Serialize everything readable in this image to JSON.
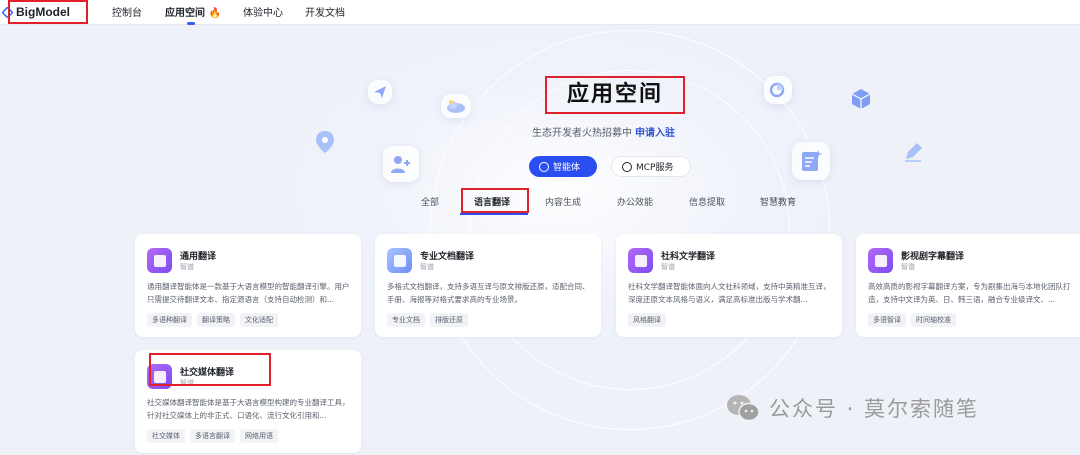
{
  "brand": {
    "name": "BigModel"
  },
  "nav": {
    "items": [
      {
        "label": "控制台"
      },
      {
        "label": "应用空间 🔥"
      },
      {
        "label": "体验中心"
      },
      {
        "label": "开发文档"
      }
    ]
  },
  "hero": {
    "title": "应用空间",
    "subtitle": "生态开发者火热招募中",
    "subtitle_link": "申请入驻",
    "buttons": [
      {
        "label": "智能体"
      },
      {
        "label": "MCP服务"
      }
    ]
  },
  "tabs": [
    {
      "label": "全部"
    },
    {
      "label": "语言翻译"
    },
    {
      "label": "内容生成"
    },
    {
      "label": "办公效能"
    },
    {
      "label": "信息提取"
    },
    {
      "label": "智慧教育"
    }
  ],
  "cards": [
    {
      "title": "通用翻译",
      "category": "智谱",
      "desc": "通用翻译智能体是一款基于大语言模型的智能翻译引擎。用户只需提交待翻译文本、指定源语言（支持自动检测）和...",
      "tags": [
        "多语种翻译",
        "翻译策略",
        "文化适配"
      ]
    },
    {
      "title": "专业文档翻译",
      "category": "智谱",
      "desc": "多格式文档翻译，支持多语互译与原文排版还原，适配合同、手册、海报等对格式要求高的专业场景。",
      "tags": [
        "专业文档",
        "排版还原"
      ]
    },
    {
      "title": "社科文学翻译",
      "category": "智谱",
      "desc": "社科文学翻译智能体面向人文社科领域，支持中英精准互译，深度还原文本风格与语义，满足高标准出版与学术翻...",
      "tags": [
        "风格翻译"
      ]
    },
    {
      "title": "影视剧字幕翻译",
      "category": "智谱",
      "desc": "高效高质的影视字幕翻译方案，专为剧集出海与本地化团队打造，支持中文译为英、日、韩三语，融合专业级译文、...",
      "tags": [
        "多语智译",
        "时间轴校准"
      ]
    },
    {
      "title": "社交媒体翻译",
      "category": "智谱",
      "desc": "社交媒体翻译智能体是基于大语言模型构建的专业翻译工具，针对社交媒体上的非正式、口语化、流行文化引用和...",
      "tags": [
        "社交媒体",
        "多语言翻译",
        "网络用语"
      ]
    }
  ],
  "watermark": {
    "text": "公众号 · 莫尔索随笔"
  },
  "colors": {
    "accent": "#2b4ef0",
    "annotation": "#e0202a",
    "card_icon": "#8a52f2"
  }
}
